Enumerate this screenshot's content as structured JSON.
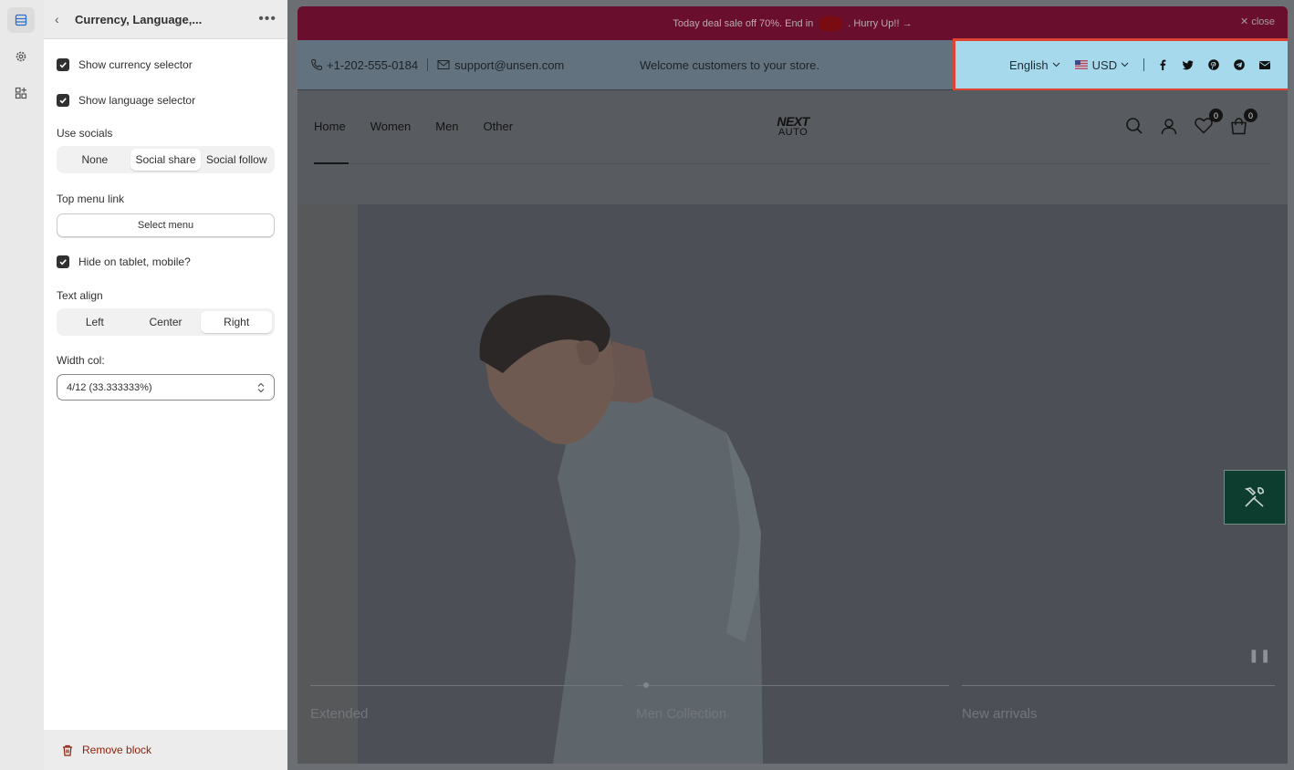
{
  "panel": {
    "title": "Currency, Language,...",
    "show_currency_label": "Show currency selector",
    "show_language_label": "Show language selector",
    "use_socials_label": "Use socials",
    "socials_options": [
      "None",
      "Social share",
      "Social follow"
    ],
    "socials_selected": "Social share",
    "top_menu_label": "Top menu link",
    "select_menu_label": "Select menu",
    "hide_mobile_label": "Hide on tablet, mobile?",
    "text_align_label": "Text align",
    "align_options": [
      "Left",
      "Center",
      "Right"
    ],
    "align_selected": "Right",
    "width_col_label": "Width col:",
    "width_col_value": "4/12 (33.333333%)",
    "remove_block_label": "Remove block"
  },
  "preview": {
    "announcement_before": "Today deal sale off 70%. End in",
    "announcement_after": ". Hurry Up!! →",
    "close_label": "close",
    "phone": "+1-202-555-0184",
    "email": "support@unsen.com",
    "welcome": "Welcome customers to your store.",
    "language": "English",
    "currency": "USD",
    "nav": [
      "Home",
      "Women",
      "Men",
      "Other"
    ],
    "logo_line1": "NEXT",
    "logo_line2": "AUTO",
    "wishlist_count": "0",
    "cart_count": "0",
    "slides": [
      "Extended",
      "Men Collection",
      "New arrivals"
    ]
  },
  "colors": {
    "highlight_bg": "#a6d9ec",
    "highlight_border": "#de4436",
    "announcement_bg": "#6a0e2e",
    "tool_bg": "#0d3d2f"
  }
}
